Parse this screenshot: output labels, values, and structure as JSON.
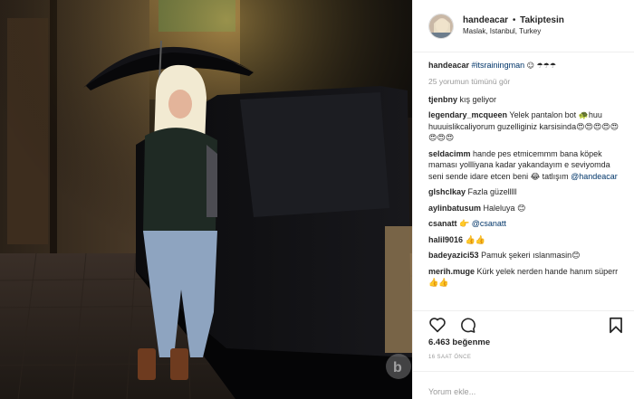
{
  "header": {
    "username": "handeacar",
    "separator": "•",
    "follow_label": "Takiptesin",
    "location": "Maslak, Istanbul, Turkey"
  },
  "caption": {
    "username": "handeacar",
    "hashtag": "#itsrainingman",
    "emoji": "☺ ☂☂☂"
  },
  "view_all_label": "25 yorumun tümünü gör",
  "comments": [
    {
      "user": "tjenbny",
      "text": "kış geliyor"
    },
    {
      "user": "legendary_mcqueen",
      "text": "Yelek pantalon bot 🐢huu huuuislikcaliyorum guzelliginiz karsisinda😍😍😍😍😍😍😍😍"
    },
    {
      "user": "seldacimm",
      "text": "hande pes etmicemmm bana köpek maması yollliyana kadar yakandayım e seviyomda seni sende idare etcen beni 😂 tatlışım",
      "mention": "@handeacar"
    },
    {
      "user": "glshclkay",
      "text": "Fazla güzelllll"
    },
    {
      "user": "aylinbatusum",
      "text": "Haleluya 😊"
    },
    {
      "user": "csanatt",
      "text": "👉",
      "mention": "@csanatt"
    },
    {
      "user": "halil9016",
      "text": "👍👍"
    },
    {
      "user": "badeyazici53",
      "text": "Pamuk şekeri ıslanmasin😊"
    },
    {
      "user": "merih.muge",
      "text": "Kürk yelek nerden hande hanım süperr👍👍"
    }
  ],
  "actions": {
    "like_icon": "heart-outline-icon",
    "comment_icon": "speech-bubble-icon",
    "save_icon": "bookmark-icon"
  },
  "likes_label": "6.463 beğenme",
  "time_label": "16 SAAT ÖNCE",
  "comment_input": {
    "placeholder": "Yorum ekle..."
  },
  "colors": {
    "text": "#262626",
    "muted": "#999999",
    "link": "#003569",
    "border": "#efefef"
  }
}
